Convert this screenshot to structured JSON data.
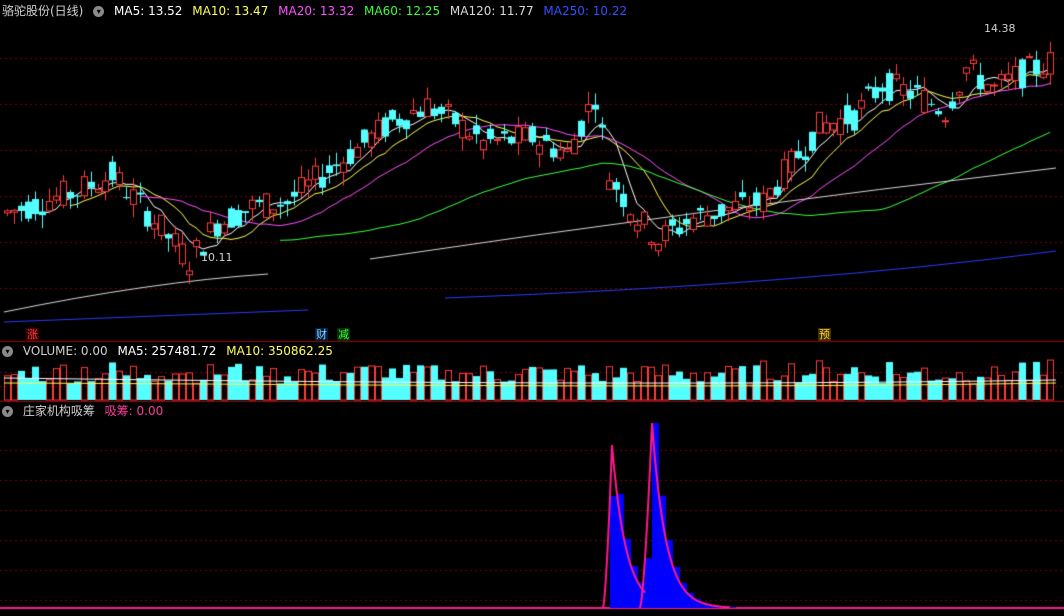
{
  "colors": {
    "up": "#ff3c3c",
    "down": "#54ffff",
    "ma5": "#ffffff",
    "ma10": "#ffff50",
    "ma20": "#ff50ff",
    "ma60": "#3cff3c",
    "ma120": "#d8d8d8",
    "ma250": "#2a3cff",
    "grid": "#7a0000",
    "divider": "#a00000",
    "xishou_fill": "#0000ff",
    "xishou_line": "#ff1a8c"
  },
  "price_header": {
    "stock": "骆驼股份(日线)",
    "ma5": "MA5: 13.52",
    "ma10": "MA10: 13.47",
    "ma20": "MA20: 13.32",
    "ma60": "MA60: 12.25",
    "ma120": "MA120: 11.77",
    "ma250": "MA250: 10.22"
  },
  "price_labels": {
    "high": "14.38",
    "low": "10.11"
  },
  "markers": {
    "zhang": "涨",
    "cai": "财",
    "jian": "减",
    "yu": "预"
  },
  "volume_header": {
    "title": "VOLUME: 0.00",
    "ma5": "MA5: 257481.72",
    "ma10": "MA10: 350862.25"
  },
  "indicator_header": {
    "title": "庄家机构吸筹",
    "series": "吸筹: 0.00"
  }
}
